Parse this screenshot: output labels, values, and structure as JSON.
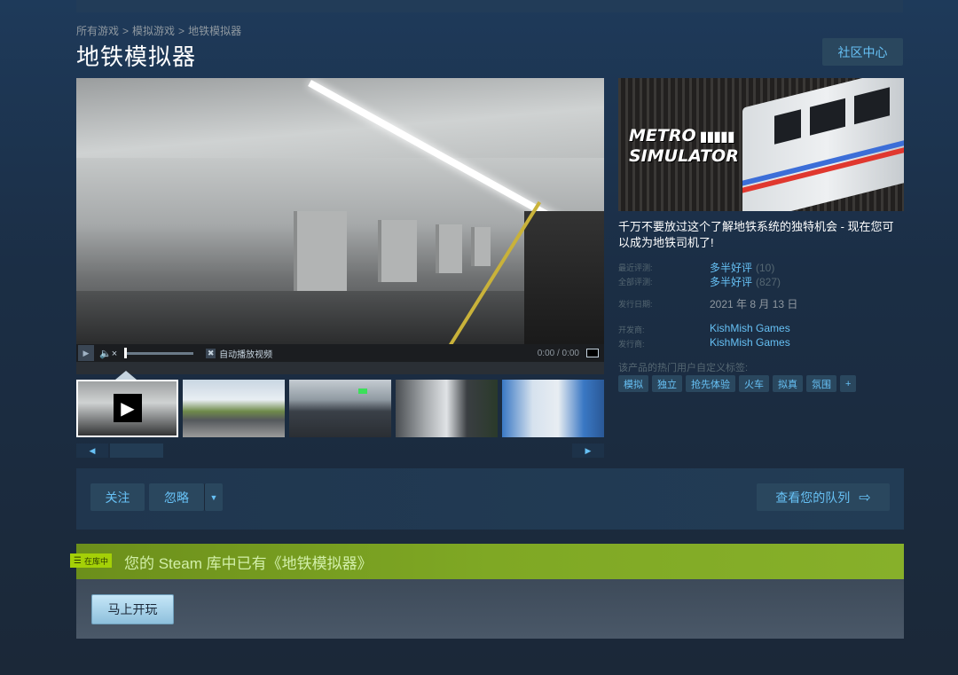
{
  "breadcrumb": [
    "所有游戏",
    "模拟游戏",
    "地铁模拟器"
  ],
  "title": "地铁模拟器",
  "community_button": "社区中心",
  "video_controls": {
    "autoplay_label": "自动播放视频",
    "time": "0:00 / 0:00"
  },
  "capsule_logo": {
    "line1": "METRO",
    "line2": "SIMULATOR"
  },
  "description": "千万不要放过这个了解地铁系统的独特机会 - 现在您可以成为地铁司机了!",
  "reviews": {
    "recent_label": "最近评测:",
    "recent_value": "多半好评",
    "recent_count": "(10)",
    "all_label": "全部评测:",
    "all_value": "多半好评",
    "all_count": "(827)"
  },
  "release": {
    "label": "发行日期:",
    "value": "2021 年 8 月 13 日"
  },
  "developer": {
    "label": "开发商:",
    "value": "KishMish Games"
  },
  "publisher": {
    "label": "发行商:",
    "value": "KishMish Games"
  },
  "tags_label": "该产品的热门用户自定义标签:",
  "tags": [
    "模拟",
    "独立",
    "抢先体验",
    "火车",
    "拟真",
    "氛围",
    "+"
  ],
  "actions": {
    "follow": "关注",
    "ignore": "忽略",
    "queue": "查看您的队列"
  },
  "library": {
    "badge": "在库中",
    "text": "您的 Steam 库中已有《地铁模拟器》",
    "play_button": "马上开玩"
  }
}
